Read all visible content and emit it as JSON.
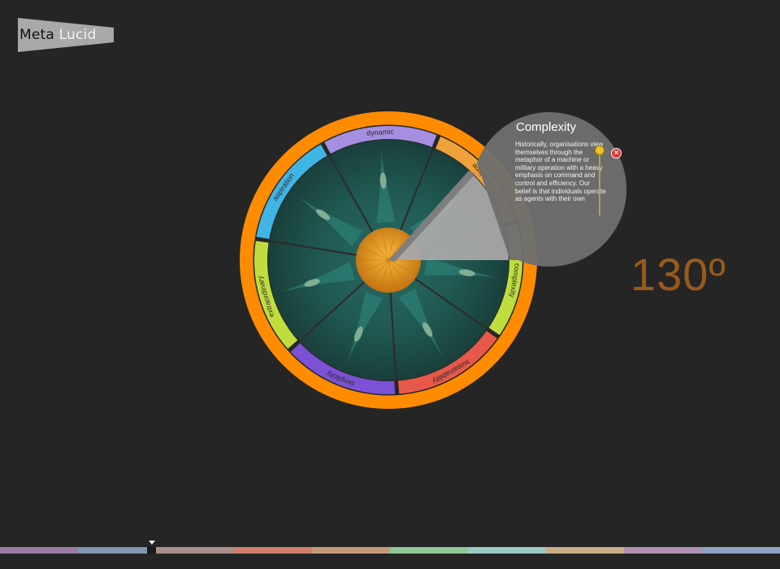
{
  "app": {
    "logo_word1": "Meta",
    "logo_word2": "Lucid"
  },
  "wheel": {
    "outer_ring_color": "#ff8c00",
    "segments": [
      {
        "label": "adaptive",
        "color": "#f0a13a",
        "selected": true
      },
      {
        "label": "complexity",
        "color": "#bfde3e"
      },
      {
        "label": "sustainability",
        "color": "#e8584a"
      },
      {
        "label": "simplicity",
        "color": "#7b52d6"
      },
      {
        "label": "extraordinary",
        "color": "#bfde3e"
      },
      {
        "label": "aspiration",
        "color": "#3fb5e6"
      },
      {
        "label": "dynamic",
        "color": "#a58fe0"
      }
    ],
    "hub_color": "#f2a21a"
  },
  "angle": {
    "value": "130º"
  },
  "info": {
    "title": "Complexity",
    "body": "Historically, organisations view themselves through the metaphor of a machine or military operation with a heavy emphasis on command and control and efficiency. Our belief is that individuals operate as agents with their own"
  },
  "close": {
    "symbol": "×"
  },
  "timeline": {
    "colors": [
      "#9b7aa4",
      "#7f97b0",
      "#a88f8a",
      "#d17d6c",
      "#c59a7a",
      "#8fc796",
      "#9bc9c2",
      "#c9ad86",
      "#b390b3",
      "#8fa3c6"
    ]
  }
}
